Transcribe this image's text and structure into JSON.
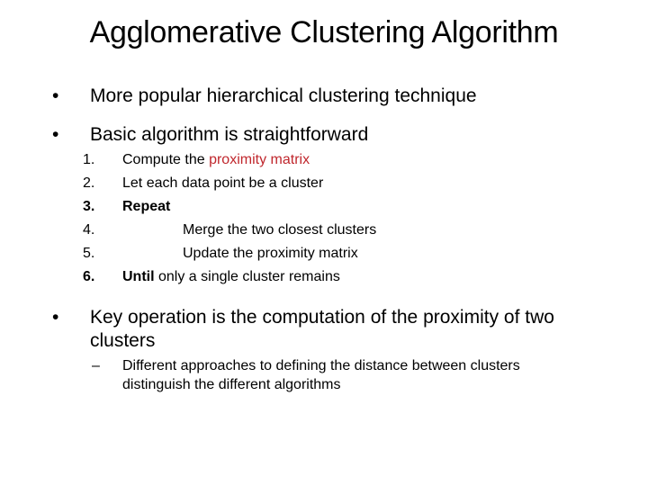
{
  "slide": {
    "title": "Agglomerative Clustering Algorithm",
    "accent_color": "#c0272d",
    "bullets": [
      {
        "marker": "•",
        "text": "More popular hierarchical clustering technique"
      },
      {
        "marker": "•",
        "text": "Basic algorithm is straightforward"
      },
      {
        "marker": "•",
        "text_line1": "Key operation is the computation of the proximity of two",
        "text_line2": "clusters"
      }
    ],
    "steps": [
      {
        "number": "1.",
        "prefix": "Compute the ",
        "highlight": "proximity matrix"
      },
      {
        "number": "2.",
        "text": "Let each data point be a cluster"
      },
      {
        "number": "3.",
        "text": "Repeat"
      },
      {
        "number": "4.",
        "text": "Merge the two closest clusters"
      },
      {
        "number": "5.",
        "text": "Update the proximity matrix"
      },
      {
        "number": "6.",
        "bold": "Until",
        "rest": " only a single cluster remains"
      }
    ],
    "sub_bullet": {
      "marker": "–",
      "line1": "Different approaches to defining the distance between clusters",
      "line2": "distinguish the different algorithms"
    }
  }
}
